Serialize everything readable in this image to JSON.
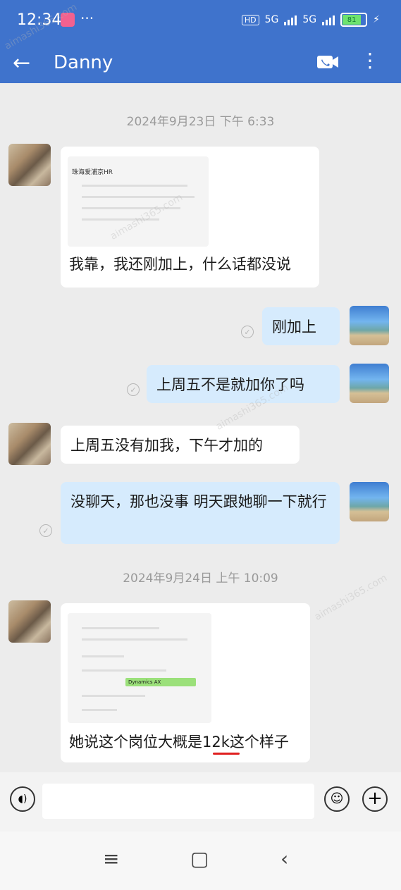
{
  "status_bar": {
    "time": "12:34",
    "dots": "···",
    "hd_label": "HD",
    "net1": "5G",
    "net2": "5G",
    "battery": "81"
  },
  "app_bar": {
    "title": "Danny",
    "back_icon": "arrow-left-icon",
    "video_icon": "video-call-icon",
    "more_icon": "more-vertical-icon"
  },
  "chat": {
    "timestamps": [
      "2024年9月23日  下午 6:33",
      "2024年9月24日  上午 10:09"
    ],
    "messages": [
      {
        "side": "left",
        "image_caption": "珠海爱浦京HR",
        "text": "我靠，我还刚加上，什么话都没说"
      },
      {
        "side": "right",
        "text": "刚加上"
      },
      {
        "side": "right",
        "text": "上周五不是就加你了吗"
      },
      {
        "side": "left",
        "text": "上周五没有加我，下午才加的"
      },
      {
        "side": "right",
        "text": "没聊天，那也没事 明天跟她聊一下就行"
      },
      {
        "side": "left",
        "image_chip": "Dynamics AX",
        "text_before": "她说这个岗位大概是",
        "text_highlight": "12k",
        "text_after": "这个样子"
      }
    ]
  },
  "composer": {
    "voice_icon": "voice-icon",
    "emoji_icon": "emoji-icon",
    "plus_icon": "plus-icon"
  },
  "nav": {
    "menu": "≡",
    "home": "▢",
    "back": "‹"
  },
  "colors": {
    "header": "#3f73cc",
    "bubble_sent": "#d6ebfd",
    "bubble_received": "#ffffff",
    "highlight_underline": "#e02020"
  },
  "watermark": "aimashi365.com"
}
